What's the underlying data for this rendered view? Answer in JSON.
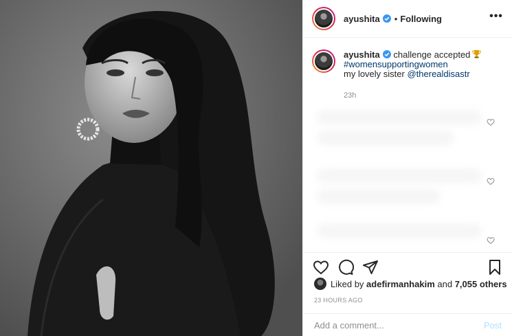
{
  "header": {
    "username": "ayushita",
    "separator": "•",
    "follow_status": "Following",
    "more_label": "•••"
  },
  "caption": {
    "username": "ayushita",
    "text": "challenge accepted",
    "hashtag": "#womensupportingwomen",
    "line3_text": "my lovely sister",
    "mention": "@therealdisastr",
    "time": "23h"
  },
  "likes": {
    "prefix": "Liked by",
    "user": "adefirmanhakim",
    "conjunction": "and",
    "others": "7,055 others"
  },
  "timestamp": "23 HOURS AGO",
  "comment_box": {
    "placeholder": "Add a comment...",
    "post_label": "Post"
  },
  "icons": {
    "verified": "verified-badge-icon",
    "trophy": "trophy-emoji-icon",
    "like": "heart-icon",
    "comment": "comment-icon",
    "share": "paper-plane-icon",
    "save": "bookmark-icon"
  },
  "colors": {
    "verified_blue": "#3897f0",
    "link_blue": "#00376b",
    "post_button_disabled": "#b2dffc",
    "muted_text": "#8e8e8e"
  }
}
